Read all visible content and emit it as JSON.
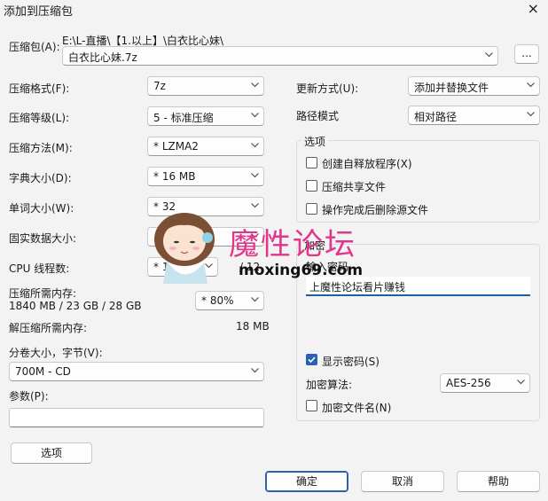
{
  "window": {
    "title": "添加到压缩包",
    "close_icon": "×"
  },
  "archive": {
    "label": "压缩包(A):",
    "path": "E:\\L-直播\\【1.以上】\\白衣比心妹\\",
    "filename": "白衣比心妹.7z",
    "browse_label": "..."
  },
  "left": {
    "format": {
      "label": "压缩格式(F):",
      "value": "7z"
    },
    "level": {
      "label": "压缩等级(L):",
      "value": "5 - 标准压缩"
    },
    "method": {
      "label": "压缩方法(M):",
      "value": "*  LZMA2"
    },
    "dict": {
      "label": "字典大小(D):",
      "value": "*  16 MB"
    },
    "word": {
      "label": "单词大小(W):",
      "value": "*  32"
    },
    "solid": {
      "label": "固实数据大小:",
      "value": ""
    },
    "threads": {
      "label": "CPU 线程数:",
      "value": "*  1",
      "total": "/ 12"
    },
    "mem": {
      "label": "压缩所需内存:",
      "value": "1840 MB / 23 GB / 28 GB",
      "percent": "*  80%"
    },
    "decomp": {
      "label": "解压缩所需内存:",
      "value": "18 MB"
    },
    "volume": {
      "label": "分卷大小，字节(V):",
      "value": "700M - CD"
    },
    "params": {
      "label": "参数(P):",
      "value": ""
    },
    "options_btn": "选项"
  },
  "right": {
    "update": {
      "label": "更新方式(U):",
      "value": "添加并替换文件"
    },
    "path_mode": {
      "label": "路径模式",
      "value": "相对路径"
    },
    "options": {
      "title": "选项",
      "items": [
        {
          "label": "创建自释放程序(X)",
          "checked": false
        },
        {
          "label": "压缩共享文件",
          "checked": false
        },
        {
          "label": "操作完成后删除源文件",
          "checked": false
        }
      ]
    },
    "encrypt": {
      "title": "加密",
      "pwd_label": "输入密码",
      "pwd_value": "上魔性论坛看片赚钱",
      "show_pwd": {
        "label": "显示密码(S)",
        "checked": true
      },
      "algo": {
        "label": "加密算法:",
        "value": "AES-256"
      },
      "enc_names": {
        "label": "加密文件名(N)",
        "checked": false
      }
    }
  },
  "buttons": {
    "ok": "确定",
    "cancel": "取消",
    "help": "帮助"
  },
  "watermark": {
    "text": "魔性论坛",
    "url": "moxing69.com"
  },
  "colors": {
    "accent": "#2a62b3",
    "watermark": "#e0368c"
  }
}
